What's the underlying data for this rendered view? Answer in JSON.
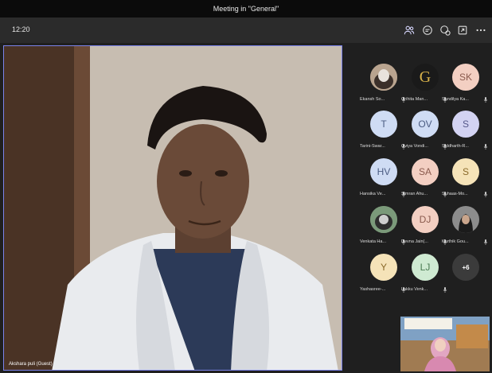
{
  "window": {
    "title": "Meeting in \"General\""
  },
  "toolbar": {
    "timer": "12:20",
    "icons": [
      "people-icon",
      "chat-icon",
      "reactions-icon",
      "share-icon",
      "more-icon"
    ]
  },
  "main_video": {
    "speaker_name": "Akshara puli (Guest)"
  },
  "participants": [
    {
      "name": "Ekansh So...",
      "initials": "",
      "bg": "#9a7f6b"
    },
    {
      "name": "Grihita Man...",
      "initials": "G",
      "bg": "#1a1a1a"
    },
    {
      "name": "Sandilya Ka...",
      "initials": "SK",
      "bg": "#f3cfc2"
    },
    {
      "name": "Tarini-Swar...",
      "initials": "T",
      "bg": "#cfdcf4"
    },
    {
      "name": "Oviya Vondi...",
      "initials": "OV",
      "bg": "#cfdcf4"
    },
    {
      "name": "Siddharth-R...",
      "initials": "S",
      "bg": "#d3d3f2"
    },
    {
      "name": "Hansika Ve...",
      "initials": "HV",
      "bg": "#cfdcf4"
    },
    {
      "name": "Simran Ahu...",
      "initials": "SA",
      "bg": "#f3cfc2"
    },
    {
      "name": "Suhaas-Mo...",
      "initials": "S",
      "bg": "#f5e3b8"
    },
    {
      "name": "Venkata Ha...",
      "initials": "",
      "bg": "#6f8a6a"
    },
    {
      "name": "Devna Jain(...",
      "initials": "DJ",
      "bg": "#f3cfc2"
    },
    {
      "name": "Karthik Gou...",
      "initials": "",
      "bg": "#3a3a3a"
    },
    {
      "name": "Yashasree-...",
      "initials": "Y",
      "bg": "#f5e3b8"
    },
    {
      "name": "Lakku Venk...",
      "initials": "LJ",
      "bg": "#cfead2"
    }
  ],
  "overflow": {
    "label": "+6"
  },
  "colors": {
    "accent": "#7b83eb",
    "background": "#1f1f1f"
  }
}
